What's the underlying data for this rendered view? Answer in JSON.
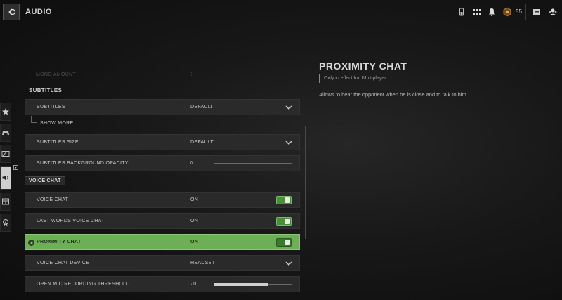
{
  "header": {
    "title": "AUDIO",
    "count": "55"
  },
  "faded_row": {
    "label": "MONO AMOUNT",
    "value": "1"
  },
  "subtitles_section": {
    "title": "SUBTITLES",
    "subtitles": {
      "label": "SUBTITLES",
      "value": "DEFAULT"
    },
    "show_more": "SHOW MORE",
    "subtitles_size": {
      "label": "SUBTITLES SIZE",
      "value": "DEFAULT"
    },
    "bg_opacity": {
      "label": "SUBTITLES BACKGROUND OPACITY",
      "value": "0",
      "level": 0
    }
  },
  "voice_section": {
    "title": "VOICE CHAT",
    "voice_chat": {
      "label": "VOICE CHAT",
      "value": "ON"
    },
    "last_words": {
      "label": "LAST WORDS VOICE CHAT",
      "value": "ON"
    },
    "proximity": {
      "label": "PROXIMITY CHAT",
      "value": "ON"
    },
    "device": {
      "label": "VOICE CHAT DEVICE",
      "value": "HEADSET"
    },
    "threshold": {
      "label": "OPEN MIC RECORDING THRESHOLD",
      "value": "70",
      "level": 0.7
    }
  },
  "detail": {
    "title": "PROXIMITY CHAT",
    "note": "Only in effect for: Multiplayer",
    "description": "Allows to hear the opponent when he is close and to talk to him."
  },
  "colors": {
    "accent_green": "#6dae57",
    "toggle_green": "#4b8f3c"
  }
}
